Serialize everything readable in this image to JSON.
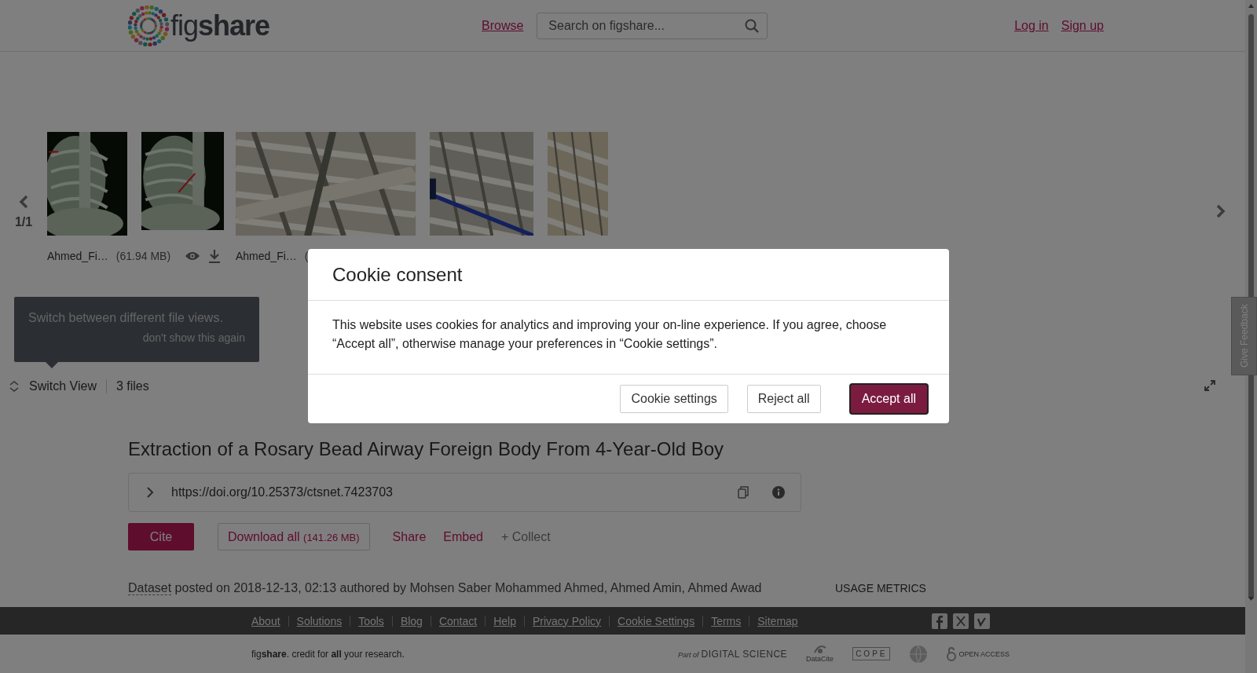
{
  "header": {
    "logo": "fig**share**",
    "nav_link": "Browse",
    "search": {
      "placeholder": "Search on figshare..."
    },
    "auth_links": [
      "Log in",
      "Sign up"
    ]
  },
  "viewer": {
    "page_indicator": "1/1",
    "files": [
      {
        "name": "Ahmed_Fi…",
        "size": "(61.94 MB)",
        "actions": true
      },
      {
        "name": "Ahmed_Fi…",
        "size": "("
      }
    ],
    "tooltip": {
      "text": "Switch between different file views.",
      "dismiss": "don't show this again"
    },
    "switch_view": "Switch View",
    "file_count": "3 files"
  },
  "article": {
    "title": "Extraction of a Rosary Bead Airway Foreign Body From 4-Year-Old Boy",
    "doi": "https://doi.org/10.25373/ctsnet.7423703",
    "actions": [
      {
        "kind": "primary",
        "label": "Cite"
      },
      {
        "kind": "outline",
        "label": "Download all",
        "extra": "(141.26 MB)"
      },
      {
        "kind": "link",
        "label": "Share"
      },
      {
        "kind": "link",
        "label": "Embed"
      },
      {
        "kind": "muted",
        "label": "+ Collect"
      }
    ],
    "item_type": "Dataset",
    "posted": "posted on 2018-12-13, 02:13 authored by Mohsen Saber Mohammed Ahmed, Ahmed Amin, Ahmed Awad",
    "usage_metrics": "USAGE METRICS"
  },
  "feedback_tab": "Give Feedback",
  "footer": {
    "links": [
      "About",
      "Solutions",
      "Tools",
      "Blog",
      "Contact",
      "Help",
      "Privacy Policy",
      "Cookie Settings",
      "Terms",
      "Sitemap"
    ],
    "tagline": "fig**share**. credit for **all** your research.",
    "partners": [
      "Part of",
      "DIGITAL SCIENCE",
      "DataCite",
      "COPE",
      "OPEN ACCESS"
    ]
  },
  "cookie_modal": {
    "title": "Cookie consent",
    "body": "This website uses cookies for analytics and improving your on-line experience. If you agree, choose “Accept all”, otherwise manage your preferences in “Cookie settings”.",
    "buttons": [
      {
        "kind": "secondary",
        "label": "Cookie settings",
        "focused": false
      },
      {
        "kind": "secondary",
        "label": "Reject all",
        "focused": false
      },
      {
        "kind": "primary",
        "label": "Accept all",
        "focused": true
      }
    ]
  }
}
